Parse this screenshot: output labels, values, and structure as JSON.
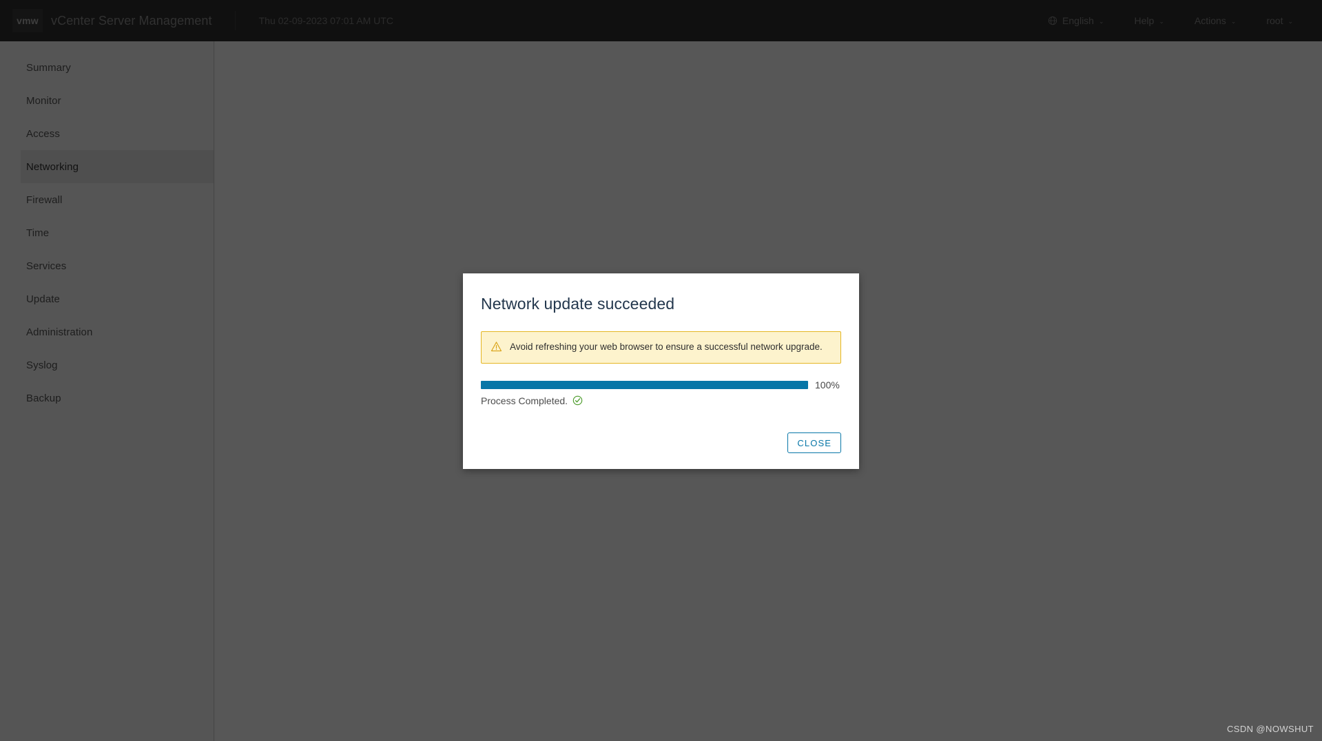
{
  "header": {
    "logo": "vmw",
    "logo_icon": "vmware-logo-icon",
    "title": "vCenter Server Management",
    "datetime": "Thu 02-09-2023 07:01 AM UTC",
    "language": {
      "icon": "globe-icon",
      "label": "English",
      "caret": "⌄"
    },
    "help": {
      "label": "Help",
      "caret": "⌄"
    },
    "actions": {
      "label": "Actions",
      "caret": "⌄"
    },
    "user": {
      "label": "root",
      "caret": "⌄"
    }
  },
  "sidebar": {
    "items": [
      {
        "label": "Summary",
        "active": false
      },
      {
        "label": "Monitor",
        "active": false
      },
      {
        "label": "Access",
        "active": false
      },
      {
        "label": "Networking",
        "active": true
      },
      {
        "label": "Firewall",
        "active": false
      },
      {
        "label": "Time",
        "active": false
      },
      {
        "label": "Services",
        "active": false
      },
      {
        "label": "Update",
        "active": false
      },
      {
        "label": "Administration",
        "active": false
      },
      {
        "label": "Syslog",
        "active": false
      },
      {
        "label": "Backup",
        "active": false
      }
    ]
  },
  "modal": {
    "title": "Network update succeeded",
    "alert": {
      "icon": "warning-triangle-icon",
      "text": "Avoid refreshing your web browser to ensure a successful network upgrade."
    },
    "progress": {
      "percent": 100,
      "percent_label": "100%",
      "fill_color": "#0776a7",
      "track_color": "#d9e4ea"
    },
    "status": {
      "text": "Process Completed.",
      "icon": "success-check-circle-icon",
      "icon_color": "#4a9a28"
    },
    "close_button": "CLOSE"
  },
  "watermark": "CSDN @NOWSHUT"
}
